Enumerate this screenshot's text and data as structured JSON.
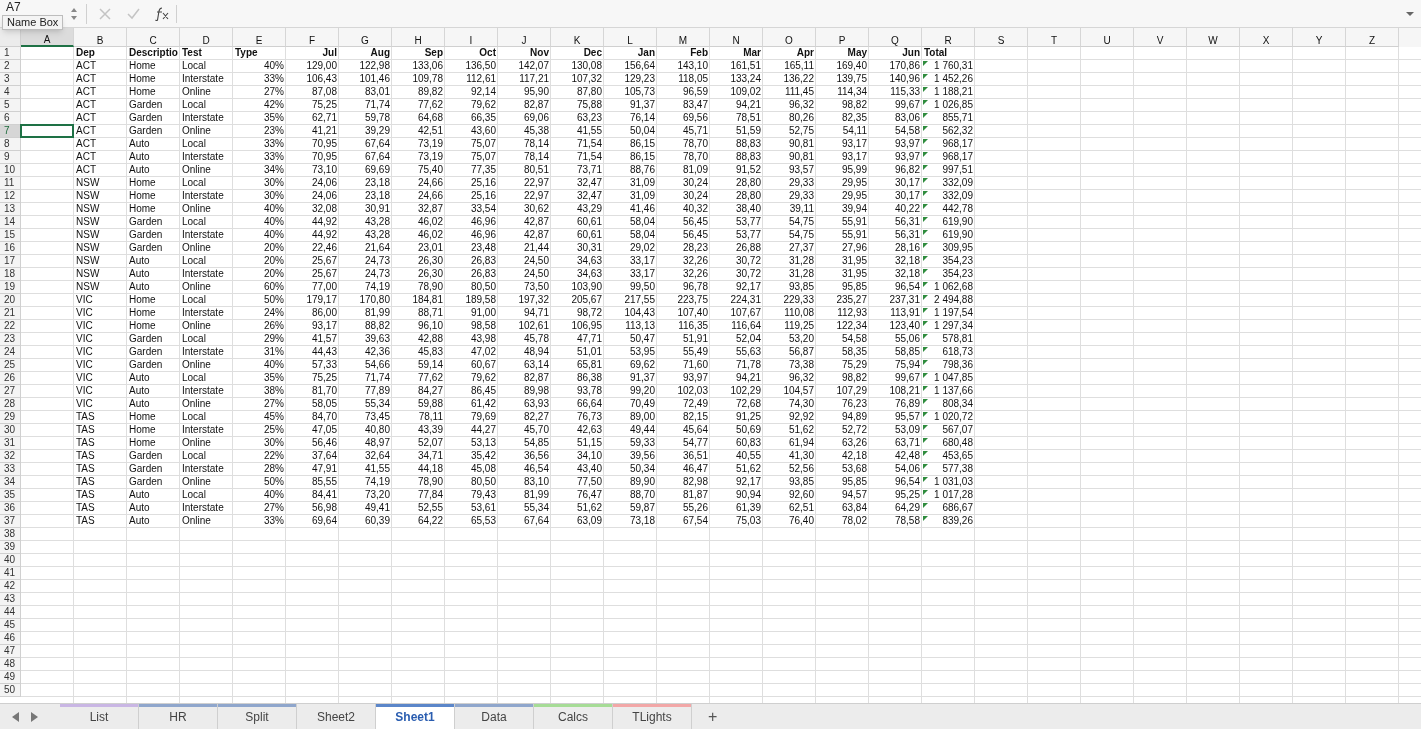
{
  "formula_bar": {
    "name_box": "A7",
    "tooltip": "Name Box"
  },
  "columns": [
    {
      "letter": "A",
      "selected": true
    },
    {
      "letter": "B",
      "selected": false
    },
    {
      "letter": "C",
      "selected": false
    },
    {
      "letter": "D",
      "selected": false
    },
    {
      "letter": "E",
      "selected": false
    },
    {
      "letter": "F",
      "selected": false
    },
    {
      "letter": "G",
      "selected": false
    },
    {
      "letter": "H",
      "selected": false
    },
    {
      "letter": "I",
      "selected": false
    },
    {
      "letter": "J",
      "selected": false
    },
    {
      "letter": "K",
      "selected": false
    },
    {
      "letter": "L",
      "selected": false
    },
    {
      "letter": "M",
      "selected": false
    },
    {
      "letter": "N",
      "selected": false
    },
    {
      "letter": "O",
      "selected": false
    },
    {
      "letter": "P",
      "selected": false
    },
    {
      "letter": "Q",
      "selected": false
    },
    {
      "letter": "R",
      "selected": false
    },
    {
      "letter": "S",
      "selected": false
    },
    {
      "letter": "T",
      "selected": false
    },
    {
      "letter": "U",
      "selected": false
    },
    {
      "letter": "V",
      "selected": false
    },
    {
      "letter": "W",
      "selected": false
    },
    {
      "letter": "X",
      "selected": false
    },
    {
      "letter": "Y",
      "selected": false
    },
    {
      "letter": "Z",
      "selected": false
    }
  ],
  "rows": [
    {
      "number": "1",
      "selected": false,
      "kind": "header",
      "cells": [
        "Dep",
        "Descriptio",
        "Test",
        "Type",
        "Jul",
        "Aug",
        "Sep",
        "Oct",
        "Nov",
        "Dec",
        "Jan",
        "Feb",
        "Mar",
        "Apr",
        "May",
        "Jun"
      ],
      "total": {
        "text": "Total",
        "flagged": false
      }
    },
    {
      "number": "2",
      "selected": false,
      "kind": "data",
      "cells": [
        "ACT",
        "Home",
        "Local",
        "40%",
        "129,00",
        "122,98",
        "133,06",
        "136,50",
        "142,07",
        "130,08",
        "156,64",
        "143,10",
        "161,51",
        "165,11",
        "169,40",
        "170,86"
      ],
      "total": {
        "text": "1 760,31",
        "flagged": true
      }
    },
    {
      "number": "3",
      "selected": false,
      "kind": "data",
      "cells": [
        "ACT",
        "Home",
        "Interstate",
        "33%",
        "106,43",
        "101,46",
        "109,78",
        "112,61",
        "117,21",
        "107,32",
        "129,23",
        "118,05",
        "133,24",
        "136,22",
        "139,75",
        "140,96"
      ],
      "total": {
        "text": "1 452,26",
        "flagged": true
      }
    },
    {
      "number": "4",
      "selected": false,
      "kind": "data",
      "cells": [
        "ACT",
        "Home",
        "Online",
        "27%",
        "87,08",
        "83,01",
        "89,82",
        "92,14",
        "95,90",
        "87,80",
        "105,73",
        "96,59",
        "109,02",
        "111,45",
        "114,34",
        "115,33"
      ],
      "total": {
        "text": "1 188,21",
        "flagged": true
      }
    },
    {
      "number": "5",
      "selected": false,
      "kind": "data",
      "cells": [
        "ACT",
        "Garden",
        "Local",
        "42%",
        "75,25",
        "71,74",
        "77,62",
        "79,62",
        "82,87",
        "75,88",
        "91,37",
        "83,47",
        "94,21",
        "96,32",
        "98,82",
        "99,67"
      ],
      "total": {
        "text": "1 026,85",
        "flagged": true
      }
    },
    {
      "number": "6",
      "selected": false,
      "kind": "data",
      "cells": [
        "ACT",
        "Garden",
        "Interstate",
        "35%",
        "62,71",
        "59,78",
        "64,68",
        "66,35",
        "69,06",
        "63,23",
        "76,14",
        "69,56",
        "78,51",
        "80,26",
        "82,35",
        "83,06"
      ],
      "total": {
        "text": "855,71",
        "flagged": true
      }
    },
    {
      "number": "7",
      "selected": true,
      "kind": "data",
      "cells": [
        "ACT",
        "Garden",
        "Online",
        "23%",
        "41,21",
        "39,29",
        "42,51",
        "43,60",
        "45,38",
        "41,55",
        "50,04",
        "45,71",
        "51,59",
        "52,75",
        "54,11",
        "54,58"
      ],
      "total": {
        "text": "562,32",
        "flagged": true
      }
    },
    {
      "number": "8",
      "selected": false,
      "kind": "data",
      "cells": [
        "ACT",
        "Auto",
        "Local",
        "33%",
        "70,95",
        "67,64",
        "73,19",
        "75,07",
        "78,14",
        "71,54",
        "86,15",
        "78,70",
        "88,83",
        "90,81",
        "93,17",
        "93,97"
      ],
      "total": {
        "text": "968,17",
        "flagged": true
      }
    },
    {
      "number": "9",
      "selected": false,
      "kind": "data",
      "cells": [
        "ACT",
        "Auto",
        "Interstate",
        "33%",
        "70,95",
        "67,64",
        "73,19",
        "75,07",
        "78,14",
        "71,54",
        "86,15",
        "78,70",
        "88,83",
        "90,81",
        "93,17",
        "93,97"
      ],
      "total": {
        "text": "968,17",
        "flagged": true
      }
    },
    {
      "number": "10",
      "selected": false,
      "kind": "data",
      "cells": [
        "ACT",
        "Auto",
        "Online",
        "34%",
        "73,10",
        "69,69",
        "75,40",
        "77,35",
        "80,51",
        "73,71",
        "88,76",
        "81,09",
        "91,52",
        "93,57",
        "95,99",
        "96,82"
      ],
      "total": {
        "text": "997,51",
        "flagged": true
      }
    },
    {
      "number": "11",
      "selected": false,
      "kind": "data",
      "cells": [
        "NSW",
        "Home",
        "Local",
        "30%",
        "24,06",
        "23,18",
        "24,66",
        "25,16",
        "22,97",
        "32,47",
        "31,09",
        "30,24",
        "28,80",
        "29,33",
        "29,95",
        "30,17"
      ],
      "total": {
        "text": "332,09",
        "flagged": true
      }
    },
    {
      "number": "12",
      "selected": false,
      "kind": "data",
      "cells": [
        "NSW",
        "Home",
        "Interstate",
        "30%",
        "24,06",
        "23,18",
        "24,66",
        "25,16",
        "22,97",
        "32,47",
        "31,09",
        "30,24",
        "28,80",
        "29,33",
        "29,95",
        "30,17"
      ],
      "total": {
        "text": "332,09",
        "flagged": true
      }
    },
    {
      "number": "13",
      "selected": false,
      "kind": "data",
      "cells": [
        "NSW",
        "Home",
        "Online",
        "40%",
        "32,08",
        "30,91",
        "32,87",
        "33,54",
        "30,62",
        "43,29",
        "41,46",
        "40,32",
        "38,40",
        "39,11",
        "39,94",
        "40,22"
      ],
      "total": {
        "text": "442,78",
        "flagged": true
      }
    },
    {
      "number": "14",
      "selected": false,
      "kind": "data",
      "cells": [
        "NSW",
        "Garden",
        "Local",
        "40%",
        "44,92",
        "43,28",
        "46,02",
        "46,96",
        "42,87",
        "60,61",
        "58,04",
        "56,45",
        "53,77",
        "54,75",
        "55,91",
        "56,31"
      ],
      "total": {
        "text": "619,90",
        "flagged": true
      }
    },
    {
      "number": "15",
      "selected": false,
      "kind": "data",
      "cells": [
        "NSW",
        "Garden",
        "Interstate",
        "40%",
        "44,92",
        "43,28",
        "46,02",
        "46,96",
        "42,87",
        "60,61",
        "58,04",
        "56,45",
        "53,77",
        "54,75",
        "55,91",
        "56,31"
      ],
      "total": {
        "text": "619,90",
        "flagged": true
      }
    },
    {
      "number": "16",
      "selected": false,
      "kind": "data",
      "cells": [
        "NSW",
        "Garden",
        "Online",
        "20%",
        "22,46",
        "21,64",
        "23,01",
        "23,48",
        "21,44",
        "30,31",
        "29,02",
        "28,23",
        "26,88",
        "27,37",
        "27,96",
        "28,16"
      ],
      "total": {
        "text": "309,95",
        "flagged": true
      }
    },
    {
      "number": "17",
      "selected": false,
      "kind": "data",
      "cells": [
        "NSW",
        "Auto",
        "Local",
        "20%",
        "25,67",
        "24,73",
        "26,30",
        "26,83",
        "24,50",
        "34,63",
        "33,17",
        "32,26",
        "30,72",
        "31,28",
        "31,95",
        "32,18"
      ],
      "total": {
        "text": "354,23",
        "flagged": true
      }
    },
    {
      "number": "18",
      "selected": false,
      "kind": "data",
      "cells": [
        "NSW",
        "Auto",
        "Interstate",
        "20%",
        "25,67",
        "24,73",
        "26,30",
        "26,83",
        "24,50",
        "34,63",
        "33,17",
        "32,26",
        "30,72",
        "31,28",
        "31,95",
        "32,18"
      ],
      "total": {
        "text": "354,23",
        "flagged": true
      }
    },
    {
      "number": "19",
      "selected": false,
      "kind": "data",
      "cells": [
        "NSW",
        "Auto",
        "Online",
        "60%",
        "77,00",
        "74,19",
        "78,90",
        "80,50",
        "73,50",
        "103,90",
        "99,50",
        "96,78",
        "92,17",
        "93,85",
        "95,85",
        "96,54"
      ],
      "total": {
        "text": "1 062,68",
        "flagged": true
      }
    },
    {
      "number": "20",
      "selected": false,
      "kind": "data",
      "cells": [
        "VIC",
        "Home",
        "Local",
        "50%",
        "179,17",
        "170,80",
        "184,81",
        "189,58",
        "197,32",
        "205,67",
        "217,55",
        "223,75",
        "224,31",
        "229,33",
        "235,27",
        "237,31"
      ],
      "total": {
        "text": "2 494,88",
        "flagged": true
      }
    },
    {
      "number": "21",
      "selected": false,
      "kind": "data",
      "cells": [
        "VIC",
        "Home",
        "Interstate",
        "24%",
        "86,00",
        "81,99",
        "88,71",
        "91,00",
        "94,71",
        "98,72",
        "104,43",
        "107,40",
        "107,67",
        "110,08",
        "112,93",
        "113,91"
      ],
      "total": {
        "text": "1 197,54",
        "flagged": true
      }
    },
    {
      "number": "22",
      "selected": false,
      "kind": "data",
      "cells": [
        "VIC",
        "Home",
        "Online",
        "26%",
        "93,17",
        "88,82",
        "96,10",
        "98,58",
        "102,61",
        "106,95",
        "113,13",
        "116,35",
        "116,64",
        "119,25",
        "122,34",
        "123,40"
      ],
      "total": {
        "text": "1 297,34",
        "flagged": true
      }
    },
    {
      "number": "23",
      "selected": false,
      "kind": "data",
      "cells": [
        "VIC",
        "Garden",
        "Local",
        "29%",
        "41,57",
        "39,63",
        "42,88",
        "43,98",
        "45,78",
        "47,71",
        "50,47",
        "51,91",
        "52,04",
        "53,20",
        "54,58",
        "55,06"
      ],
      "total": {
        "text": "578,81",
        "flagged": true
      }
    },
    {
      "number": "24",
      "selected": false,
      "kind": "data",
      "cells": [
        "VIC",
        "Garden",
        "Interstate",
        "31%",
        "44,43",
        "42,36",
        "45,83",
        "47,02",
        "48,94",
        "51,01",
        "53,95",
        "55,49",
        "55,63",
        "56,87",
        "58,35",
        "58,85"
      ],
      "total": {
        "text": "618,73",
        "flagged": true
      }
    },
    {
      "number": "25",
      "selected": false,
      "kind": "data",
      "cells": [
        "VIC",
        "Garden",
        "Online",
        "40%",
        "57,33",
        "54,66",
        "59,14",
        "60,67",
        "63,14",
        "65,81",
        "69,62",
        "71,60",
        "71,78",
        "73,38",
        "75,29",
        "75,94"
      ],
      "total": {
        "text": "798,36",
        "flagged": true
      }
    },
    {
      "number": "26",
      "selected": false,
      "kind": "data",
      "cells": [
        "VIC",
        "Auto",
        "Local",
        "35%",
        "75,25",
        "71,74",
        "77,62",
        "79,62",
        "82,87",
        "86,38",
        "91,37",
        "93,97",
        "94,21",
        "96,32",
        "98,82",
        "99,67"
      ],
      "total": {
        "text": "1 047,85",
        "flagged": true
      }
    },
    {
      "number": "27",
      "selected": false,
      "kind": "data",
      "cells": [
        "VIC",
        "Auto",
        "Interstate",
        "38%",
        "81,70",
        "77,89",
        "84,27",
        "86,45",
        "89,98",
        "93,78",
        "99,20",
        "102,03",
        "102,29",
        "104,57",
        "107,29",
        "108,21"
      ],
      "total": {
        "text": "1 137,66",
        "flagged": true
      }
    },
    {
      "number": "28",
      "selected": false,
      "kind": "data",
      "cells": [
        "VIC",
        "Auto",
        "Online",
        "27%",
        "58,05",
        "55,34",
        "59,88",
        "61,42",
        "63,93",
        "66,64",
        "70,49",
        "72,49",
        "72,68",
        "74,30",
        "76,23",
        "76,89"
      ],
      "total": {
        "text": "808,34",
        "flagged": true
      }
    },
    {
      "number": "29",
      "selected": false,
      "kind": "data",
      "cells": [
        "TAS",
        "Home",
        "Local",
        "45%",
        "84,70",
        "73,45",
        "78,11",
        "79,69",
        "82,27",
        "76,73",
        "89,00",
        "82,15",
        "91,25",
        "92,92",
        "94,89",
        "95,57"
      ],
      "total": {
        "text": "1 020,72",
        "flagged": true
      }
    },
    {
      "number": "30",
      "selected": false,
      "kind": "data",
      "cells": [
        "TAS",
        "Home",
        "Interstate",
        "25%",
        "47,05",
        "40,80",
        "43,39",
        "44,27",
        "45,70",
        "42,63",
        "49,44",
        "45,64",
        "50,69",
        "51,62",
        "52,72",
        "53,09"
      ],
      "total": {
        "text": "567,07",
        "flagged": true
      }
    },
    {
      "number": "31",
      "selected": false,
      "kind": "data",
      "cells": [
        "TAS",
        "Home",
        "Online",
        "30%",
        "56,46",
        "48,97",
        "52,07",
        "53,13",
        "54,85",
        "51,15",
        "59,33",
        "54,77",
        "60,83",
        "61,94",
        "63,26",
        "63,71"
      ],
      "total": {
        "text": "680,48",
        "flagged": true
      }
    },
    {
      "number": "32",
      "selected": false,
      "kind": "data",
      "cells": [
        "TAS",
        "Garden",
        "Local",
        "22%",
        "37,64",
        "32,64",
        "34,71",
        "35,42",
        "36,56",
        "34,10",
        "39,56",
        "36,51",
        "40,55",
        "41,30",
        "42,18",
        "42,48"
      ],
      "total": {
        "text": "453,65",
        "flagged": true
      }
    },
    {
      "number": "33",
      "selected": false,
      "kind": "data",
      "cells": [
        "TAS",
        "Garden",
        "Interstate",
        "28%",
        "47,91",
        "41,55",
        "44,18",
        "45,08",
        "46,54",
        "43,40",
        "50,34",
        "46,47",
        "51,62",
        "52,56",
        "53,68",
        "54,06"
      ],
      "total": {
        "text": "577,38",
        "flagged": true
      }
    },
    {
      "number": "34",
      "selected": false,
      "kind": "data",
      "cells": [
        "TAS",
        "Garden",
        "Online",
        "50%",
        "85,55",
        "74,19",
        "78,90",
        "80,50",
        "83,10",
        "77,50",
        "89,90",
        "82,98",
        "92,17",
        "93,85",
        "95,85",
        "96,54"
      ],
      "total": {
        "text": "1 031,03",
        "flagged": true
      }
    },
    {
      "number": "35",
      "selected": false,
      "kind": "data",
      "cells": [
        "TAS",
        "Auto",
        "Local",
        "40%",
        "84,41",
        "73,20",
        "77,84",
        "79,43",
        "81,99",
        "76,47",
        "88,70",
        "81,87",
        "90,94",
        "92,60",
        "94,57",
        "95,25"
      ],
      "total": {
        "text": "1 017,28",
        "flagged": true
      }
    },
    {
      "number": "36",
      "selected": false,
      "kind": "data",
      "cells": [
        "TAS",
        "Auto",
        "Interstate",
        "27%",
        "56,98",
        "49,41",
        "52,55",
        "53,61",
        "55,34",
        "51,62",
        "59,87",
        "55,26",
        "61,39",
        "62,51",
        "63,84",
        "64,29"
      ],
      "total": {
        "text": "686,67",
        "flagged": true
      }
    },
    {
      "number": "37",
      "selected": false,
      "kind": "data",
      "cells": [
        "TAS",
        "Auto",
        "Online",
        "33%",
        "69,64",
        "60,39",
        "64,22",
        "65,53",
        "67,64",
        "63,09",
        "73,18",
        "67,54",
        "75,03",
        "76,40",
        "78,02",
        "78,58"
      ],
      "total": {
        "text": "839,26",
        "flagged": true
      }
    },
    {
      "number": "38",
      "selected": false,
      "kind": "empty"
    },
    {
      "number": "39",
      "selected": false,
      "kind": "empty"
    },
    {
      "number": "40",
      "selected": false,
      "kind": "empty"
    },
    {
      "number": "41",
      "selected": false,
      "kind": "empty"
    },
    {
      "number": "42",
      "selected": false,
      "kind": "empty"
    },
    {
      "number": "43",
      "selected": false,
      "kind": "empty"
    },
    {
      "number": "44",
      "selected": false,
      "kind": "empty"
    },
    {
      "number": "45",
      "selected": false,
      "kind": "empty"
    },
    {
      "number": "46",
      "selected": false,
      "kind": "empty"
    },
    {
      "number": "47",
      "selected": false,
      "kind": "empty"
    },
    {
      "number": "48",
      "selected": false,
      "kind": "empty"
    },
    {
      "number": "49",
      "selected": false,
      "kind": "empty"
    },
    {
      "number": "50",
      "selected": false,
      "kind": "empty"
    }
  ],
  "sheet_tabs": [
    {
      "label": "List",
      "selected": false,
      "color": "#c9b6e4"
    },
    {
      "label": "HR",
      "selected": false,
      "color": "#8fa6cc"
    },
    {
      "label": "Split",
      "selected": false,
      "color": "#8fa6cc"
    },
    {
      "label": "Sheet2",
      "selected": false
    },
    {
      "label": "Sheet1",
      "selected": true,
      "color": "#5b86c9"
    },
    {
      "label": "Data",
      "selected": false,
      "color": "#8fa6cc"
    },
    {
      "label": "Calcs",
      "selected": false,
      "color": "#a6dc96"
    },
    {
      "label": "TLights",
      "selected": false,
      "color": "#f2a7a7"
    }
  ],
  "add_sheet": "+"
}
